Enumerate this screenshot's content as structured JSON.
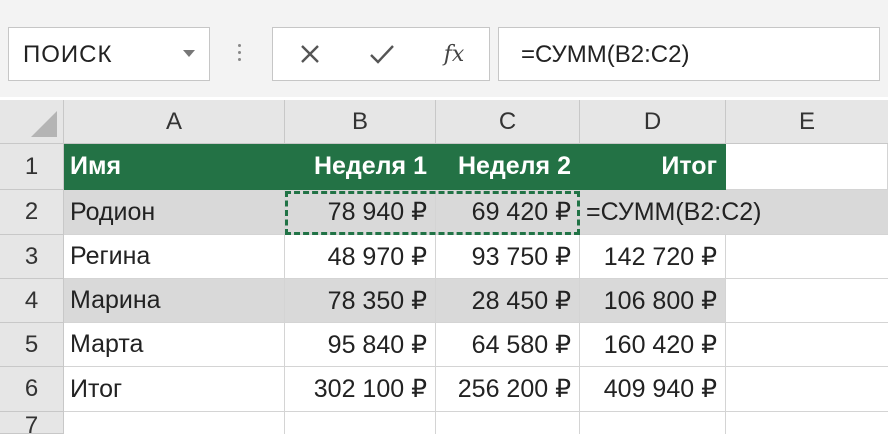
{
  "name_box": {
    "value": "ПОИСК"
  },
  "formula_bar": {
    "cancel_icon": "close-icon",
    "enter_icon": "check-icon",
    "function_label": "fx",
    "formula": "=СУММ(B2:C2)"
  },
  "columns": [
    "A",
    "B",
    "C",
    "D",
    "E"
  ],
  "rows": [
    "1",
    "2",
    "3",
    "4",
    "5",
    "6",
    "7"
  ],
  "table": {
    "header": [
      "Имя",
      "Неделя 1",
      "Неделя 2",
      "Итог"
    ],
    "body": [
      [
        "Родион",
        "78 940 ₽",
        "69 420 ₽",
        "=СУММ(B2:C2)"
      ],
      [
        "Регина",
        "48 970 ₽",
        "93 750 ₽",
        "142 720 ₽"
      ],
      [
        "Марина",
        "78 350 ₽",
        "28 450 ₽",
        "106 800 ₽"
      ],
      [
        "Марта",
        "95 840 ₽",
        "64 580 ₽",
        "160 420 ₽"
      ],
      [
        "Итог",
        "302 100 ₽",
        "256 200 ₽",
        "409 940 ₽"
      ]
    ]
  },
  "colors": {
    "header_fill": "#237245",
    "band_fill": "#d9d9d9",
    "selection_marquee": "#217346"
  }
}
